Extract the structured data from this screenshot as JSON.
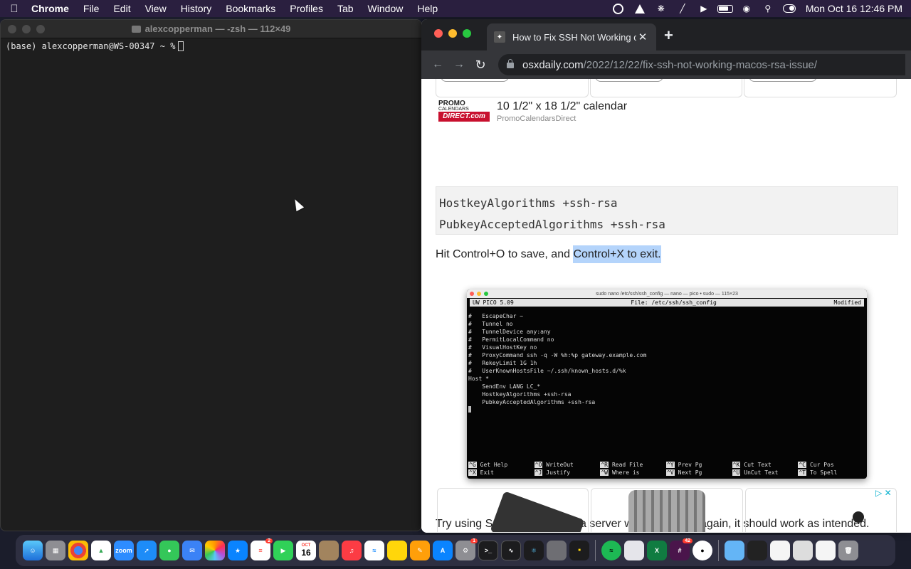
{
  "menubar": {
    "app_name": "Chrome",
    "menus": [
      "File",
      "Edit",
      "View",
      "History",
      "Bookmarks",
      "Profiles",
      "Tab",
      "Window",
      "Help"
    ],
    "clock": "Mon Oct 16  12:46 PM"
  },
  "terminal": {
    "title": "alexcopperman — -zsh — 112×49",
    "prompt": "(base) alexcopperman@WS-00347 ~ %"
  },
  "chrome": {
    "tab_title": "How to Fix SSH Not Working o",
    "url_host": "osxdaily.com",
    "url_path": "/2022/12/22/fix-ssh-not-working-macos-rsa-issue/"
  },
  "article": {
    "promo": {
      "logo_top": "PROMO",
      "logo_mid": "CALENDARS",
      "logo_bottom": "DIRECT.com",
      "title": "10 1/2\" x 18 1/2\" calendar",
      "advertiser": "PromoCalendarsDirect"
    },
    "code_lines": [
      "HostkeyAlgorithms +ssh-rsa",
      "PubkeyAcceptedAlgorithms +ssh-rsa"
    ],
    "para1_before": "Hit Control+O to save, and ",
    "para1_highlight": "Control+X to exit.",
    "para2": "Try using SSH to connect to a server with RSA keys again, it should work as intended."
  },
  "screenshot": {
    "window_title": "sudo nano /etc/ssh/ssh_config — nano — pico • sudo — 115×23",
    "header_left": "UW PICO 5.09",
    "header_center": "File: /etc/ssh/ssh_config",
    "header_right": "Modified",
    "lines": [
      "#   EscapeChar ~",
      "#   Tunnel no",
      "#   TunnelDevice any:any",
      "#   PermitLocalCommand no",
      "#   VisualHostKey no",
      "#   ProxyCommand ssh -q -W %h:%p gateway.example.com",
      "#   RekeyLimit 1G 1h",
      "#   UserKnownHostsFile ~/.ssh/known_hosts.d/%k",
      "Host *",
      "    SendEnv LANG LC_*",
      "    HostkeyAlgorithms +ssh-rsa",
      "    PubkeyAcceptedAlgorithms +ssh-rsa"
    ],
    "shortcuts": [
      {
        "key": "^G",
        "label": "Get Help"
      },
      {
        "key": "^O",
        "label": "WriteOut"
      },
      {
        "key": "^R",
        "label": "Read File"
      },
      {
        "key": "^Y",
        "label": "Prev Pg"
      },
      {
        "key": "^K",
        "label": "Cut Text"
      },
      {
        "key": "^C",
        "label": "Cur Pos"
      },
      {
        "key": "^X",
        "label": "Exit"
      },
      {
        "key": "^J",
        "label": "Justify"
      },
      {
        "key": "^W",
        "label": "Where is"
      },
      {
        "key": "^V",
        "label": "Next Pg"
      },
      {
        "key": "^U",
        "label": "UnCut Text"
      },
      {
        "key": "^T",
        "label": "To Spell"
      }
    ]
  },
  "dock": {
    "calendar_month": "OCT",
    "calendar_day": "16",
    "badges": {
      "reminders": "2",
      "settings": "1",
      "slack": "42"
    }
  },
  "colors": {
    "close": "#ff5f57",
    "minimize": "#febc2e",
    "zoom": "#28c840",
    "highlight": "#b4d4fb"
  }
}
